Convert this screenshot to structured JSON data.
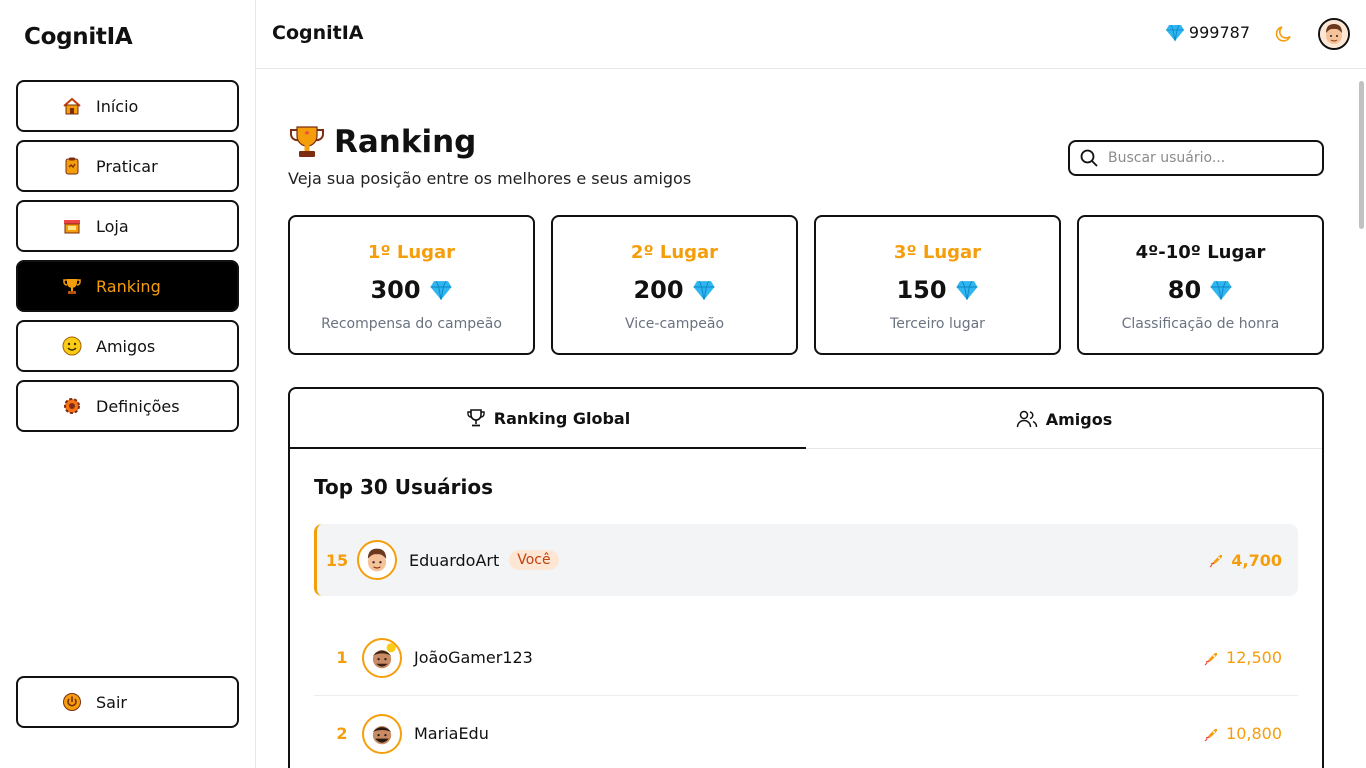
{
  "sidebar": {
    "brand": "CognitIA",
    "items": [
      {
        "label": "Início",
        "icon": "home-icon"
      },
      {
        "label": "Praticar",
        "icon": "clipboard-icon"
      },
      {
        "label": "Loja",
        "icon": "store-icon"
      },
      {
        "label": "Ranking",
        "icon": "trophy-icon",
        "active": true
      },
      {
        "label": "Amigos",
        "icon": "smiley-icon"
      },
      {
        "label": "Definições",
        "icon": "gear-icon"
      }
    ],
    "logout_label": "Sair"
  },
  "header": {
    "title": "CognitIA",
    "gems": "999787"
  },
  "page": {
    "title": "Ranking",
    "subtitle": "Veja sua posição entre os melhores e seus amigos",
    "search_placeholder": "Buscar usuário..."
  },
  "rewards": [
    {
      "place": "1º Lugar",
      "amount": "300",
      "desc": "Recompensa do campeão"
    },
    {
      "place": "2º Lugar",
      "amount": "200",
      "desc": "Vice-campeão"
    },
    {
      "place": "3º Lugar",
      "amount": "150",
      "desc": "Terceiro lugar"
    },
    {
      "place": "4º-10º Lugar",
      "amount": "80",
      "desc": "Classificação de honra"
    }
  ],
  "tabs": {
    "global": "Ranking Global",
    "friends": "Amigos"
  },
  "list": {
    "title": "Top 30 Usuários",
    "me": {
      "rank": "15",
      "name": "EduardoArt",
      "badge": "Você",
      "points": "4,700"
    },
    "users": [
      {
        "rank": "1",
        "name": "JoãoGamer123",
        "points": "12,500"
      },
      {
        "rank": "2",
        "name": "MariaEdu",
        "points": "10,800"
      }
    ]
  },
  "colors": {
    "accent": "#f59e0b",
    "gem": "#2fb5f0",
    "text": "#111111",
    "muted": "#6b7280"
  }
}
